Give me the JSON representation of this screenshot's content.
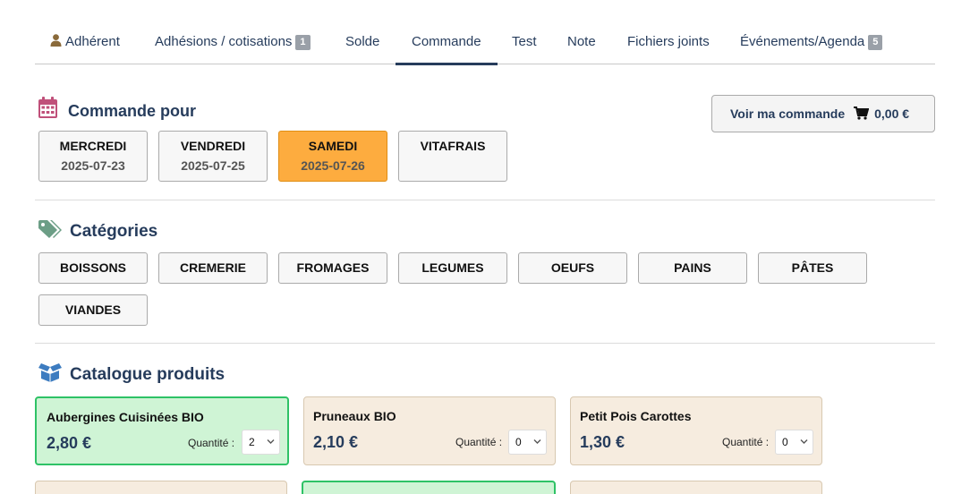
{
  "tabs": [
    {
      "label": "Adhérent",
      "icon": "user-icon"
    },
    {
      "label": "Adhésions / cotisations",
      "badge": "1"
    },
    {
      "label": "Solde"
    },
    {
      "label": "Commande",
      "active": true
    },
    {
      "label": "Test"
    },
    {
      "label": "Note"
    },
    {
      "label": "Fichiers joints"
    },
    {
      "label": "Événements/Agenda",
      "badge": "5"
    }
  ],
  "order_for": {
    "title": "Commande pour",
    "icon": "calendar-icon",
    "days": [
      {
        "name": "MERCREDI",
        "date": "2025-07-23"
      },
      {
        "name": "VENDREDI",
        "date": "2025-07-25"
      },
      {
        "name": "SAMEDI",
        "date": "2025-07-26",
        "active": true
      },
      {
        "name": "VITAFRAIS",
        "date": ""
      }
    ]
  },
  "view_order": {
    "label": "Voir ma commande",
    "total": "0,00 €",
    "icon": "cart-icon"
  },
  "categories": {
    "title": "Catégories",
    "icon": "tags-icon",
    "items": [
      "BOISSONS",
      "CREMERIE",
      "FROMAGES",
      "LEGUMES",
      "OEUFS",
      "PAINS",
      "PÂTES",
      "VIANDES"
    ]
  },
  "catalogue": {
    "title": "Catalogue produits",
    "icon": "box-open-icon",
    "quantity_label": "Quantité :",
    "products": [
      {
        "name": "Aubergines Cuisinées BIO",
        "price": "2,80 €",
        "qty": "2",
        "selected": true
      },
      {
        "name": "Pruneaux BIO",
        "price": "2,10 €",
        "qty": "0",
        "selected": false
      },
      {
        "name": "Petit Pois Carottes",
        "price": "1,30 €",
        "qty": "0",
        "selected": false
      }
    ]
  },
  "colors": {
    "accent": "#263c5c",
    "active_day": "#fdac3f",
    "selected_card": "#cff4d5",
    "card": "#f6ecdf"
  }
}
